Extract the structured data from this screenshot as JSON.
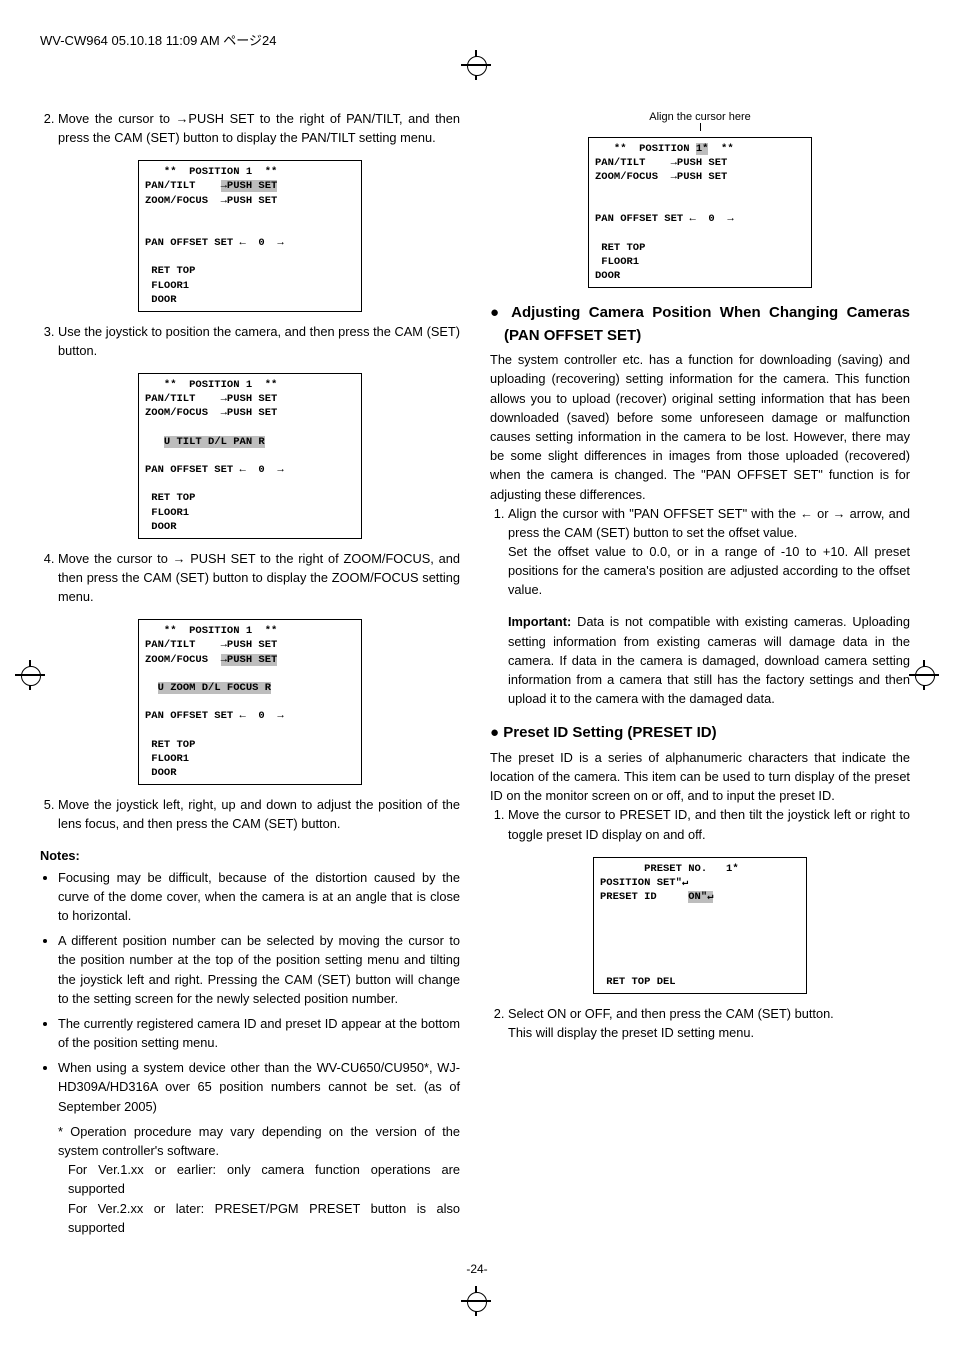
{
  "running_head": "WV-CW964  05.10.18  11:09 AM  ページ24",
  "left": {
    "step2": "Move the cursor to →PUSH SET to the right of PAN/TILT, and then press the CAM (SET) button to display the PAN/TILT setting menu.",
    "menu1": {
      "line1": "   **  POSITION 1  **",
      "l2a": "PAN/TILT    ",
      "l2b": "→PUSH SET",
      "l3": "ZOOM/FOCUS  →PUSH SET",
      "blank1": " ",
      "blank2": " ",
      "l6": "PAN OFFSET SET ←  0  →",
      "blank3": " ",
      "l8": " RET TOP",
      "l9": " FLOOR1",
      "l10": " DOOR"
    },
    "step3": "Use the joystick to position the camera, and then press the CAM (SET) button.",
    "menu2": {
      "line1": "   **  POSITION 1  **",
      "l2": "PAN/TILT    →PUSH SET",
      "l3": "ZOOM/FOCUS  →PUSH SET",
      "blank": " ",
      "l5a": "   ",
      "l5b": "U TILT D/L PAN R",
      "blank2": " ",
      "l7": "PAN OFFSET SET ←  0  →",
      "blank3": " ",
      "l8": " RET TOP",
      "l9": " FLOOR1",
      "l10": " DOOR"
    },
    "step4": "Move the cursor to → PUSH SET to the right of ZOOM/FOCUS, and then press the CAM (SET) button to display the ZOOM/FOCUS setting menu.",
    "menu3": {
      "line1": "   **  POSITION 1  **",
      "l2": "PAN/TILT    →PUSH SET",
      "l3a": "ZOOM/FOCUS  ",
      "l3b": "→PUSH SET",
      "blank": " ",
      "l5a": "  ",
      "l5b": "U ZOOM D/L FOCUS R",
      "blank2": " ",
      "l7": "PAN OFFSET SET ←  0  →",
      "blank3": " ",
      "l8": " RET TOP",
      "l9": " FLOOR1",
      "l10": " DOOR"
    },
    "step5": "Move the joystick left, right, up and down to adjust the position of the lens focus, and then press the CAM (SET) button.",
    "notes_label": "Notes:",
    "note1": "Focusing may be difficult, because of the distortion caused by the curve of the dome cover, when the camera is at an angle that is close to horizontal.",
    "note2": "A different position number can be selected by moving the cursor to the position number at the top of the position setting menu and tilting the joystick left and right. Pressing the CAM (SET) button will change to the setting screen for the newly selected position number.",
    "note3": "The currently registered camera ID and preset ID appear at the bottom of the position setting menu.",
    "note4": "When using a system device other than the WV-CU650/CU950*, WJ-HD309A/HD316A over 65 position numbers cannot be set. (as of September 2005)",
    "star1": "* Operation procedure may vary depending on the version of the system controller's software.",
    "star2": "For Ver.1.xx or earlier: only camera function operations are supported",
    "star3": "For Ver.2.xx or later: PRESET/PGM PRESET button is also supported"
  },
  "right": {
    "align_label": "Align the cursor here",
    "menuA": {
      "l1a": "   **  POSITION ",
      "l1b": "1*",
      "l1c": "  **",
      "l2": "PAN/TILT    →PUSH SET",
      "l3": "ZOOM/FOCUS  →PUSH SET",
      "blank1": " ",
      "blank2": " ",
      "l6": "PAN OFFSET SET ←  0  →",
      "blank3": " ",
      "l8": " RET TOP",
      "l9": " FLOOR1",
      "l10": "DOOR"
    },
    "h1": "● Adjusting Camera Position When Changing Cameras (PAN OFFSET SET)",
    "p1": "The system controller etc. has a function for downloading (saving) and uploading (recovering) setting information for the camera. This function allows you to upload (recover) original setting information that has been downloaded (saved) before some unforeseen damage or malfunction causes setting information in the camera to be lost. However, there may be some slight differences in images from those uploaded (recovered) when the camera is changed. The \"PAN OFFSET SET\" function is for adjusting these differences.",
    "step1a": "Align the cursor with \"PAN OFFSET SET\" with the ← or → arrow, and press the CAM (SET) button to set the offset value.",
    "step1b": "Set the offset value to 0.0, or in a range of -10 to +10. All preset positions for the camera's position are adjusted according to the offset value.",
    "imp_label": "Important:",
    "imp_text": " Data is not compatible with existing cameras. Uploading setting information from existing cameras will damage data in the camera. If data in the camera is damaged, download camera setting information from a camera that still has the factory settings and then upload it to the camera with the damaged data.",
    "h2": "● Preset ID Setting (PRESET ID)",
    "p2": "The preset ID is a series of alphanumeric characters that indicate the location of the camera. This item can be used to turn display of the preset ID on the monitor screen on or off, and to input the preset ID.",
    "stepB1": "Move the cursor to PRESET ID, and then tilt the joystick left or right to toggle preset ID display on and off.",
    "menuB": {
      "l1": "       PRESET NO.   1*",
      "l2": "POSITION SET\"↵",
      "l3a": "PRESET ID     ",
      "l3b": "ON\"↵",
      "b1": " ",
      "b2": " ",
      "b3": " ",
      "b4": " ",
      "b5": " ",
      "l9": " RET TOP DEL"
    },
    "stepB2": "Select ON or OFF, and then press the CAM (SET) button.",
    "stepB2b": "This will display the preset ID setting menu."
  },
  "pagenum": "-24-"
}
